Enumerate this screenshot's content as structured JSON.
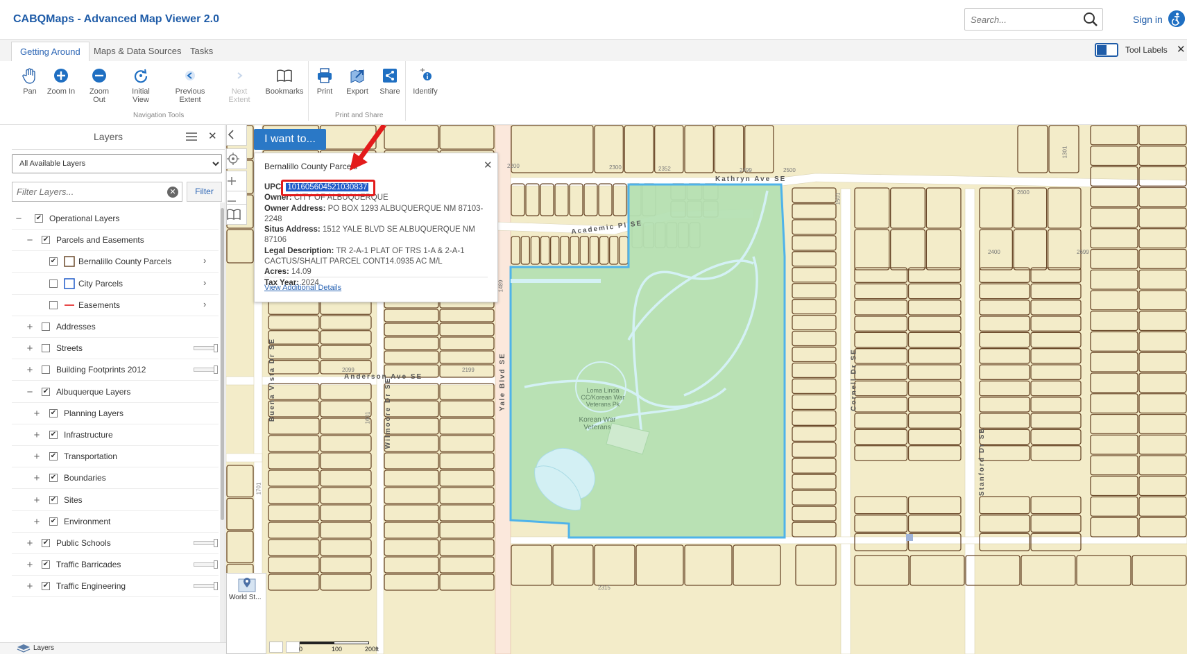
{
  "header": {
    "app_title": "CABQMaps - Advanced Map Viewer 2.0",
    "search_placeholder": "Search...",
    "sign_in": "Sign in"
  },
  "ribbon": {
    "tabs": [
      {
        "label": "Getting Around",
        "active": true
      },
      {
        "label": "Maps & Data Sources",
        "active": false
      },
      {
        "label": "Tasks",
        "active": false
      }
    ],
    "tool_labels": "Tool Labels",
    "tools": {
      "pan": "Pan",
      "zoom_in": "Zoom In",
      "zoom_out": "Zoom Out",
      "initial_view": "Initial View",
      "previous_extent": "Previous Extent",
      "next_extent": "Next Extent",
      "bookmarks": "Bookmarks",
      "print": "Print",
      "export": "Export",
      "share": "Share",
      "identify": "Identify"
    },
    "groups": {
      "navigation": "Navigation Tools",
      "print_share": "Print and Share"
    }
  },
  "layers_panel": {
    "title": "Layers",
    "selected_source": "All Available Layers",
    "filter_placeholder": "Filter Layers...",
    "filter_button": "Filter",
    "rows": [
      {
        "label": "Operational Layers",
        "expander": "−",
        "checked": true,
        "level": 0
      },
      {
        "label": "Parcels and Easements",
        "expander": "−",
        "checked": true,
        "level": 1
      },
      {
        "label": "Bernalillo County Parcels",
        "checked": true,
        "level": 2,
        "symbol": "parcel-brown"
      },
      {
        "label": "City Parcels",
        "checked": false,
        "level": 2,
        "symbol": "parcel-blue"
      },
      {
        "label": "Easements",
        "checked": false,
        "level": 2,
        "symbol": "line-red"
      },
      {
        "label": "Addresses",
        "expander": "+",
        "checked": false,
        "level": 1
      },
      {
        "label": "Streets",
        "expander": "+",
        "checked": false,
        "level": 1
      },
      {
        "label": "Building Footprints 2012",
        "expander": "+",
        "checked": false,
        "level": 1
      },
      {
        "label": "Albuquerque Layers",
        "expander": "−",
        "checked": true,
        "level": 1
      },
      {
        "label": "Planning Layers",
        "expander": "+",
        "checked": true,
        "level": 2
      },
      {
        "label": "Infrastructure",
        "expander": "+",
        "checked": true,
        "level": 2
      },
      {
        "label": "Transportation",
        "expander": "+",
        "checked": true,
        "level": 2
      },
      {
        "label": "Boundaries",
        "expander": "+",
        "checked": true,
        "level": 2
      },
      {
        "label": "Sites",
        "expander": "+",
        "checked": true,
        "level": 2
      },
      {
        "label": "Environment",
        "expander": "+",
        "checked": true,
        "level": 2
      },
      {
        "label": "Public Schools",
        "expander": "+",
        "checked": true,
        "level": 1
      },
      {
        "label": "Traffic Barricades",
        "expander": "+",
        "checked": true,
        "level": 1
      },
      {
        "label": "Traffic Engineering",
        "expander": "+",
        "checked": true,
        "level": 1
      }
    ],
    "footer_label": "Layers"
  },
  "map": {
    "i_want_to": "I want to...",
    "basemap_label": "World St...",
    "scale_labels": [
      "0",
      "100",
      "200ft"
    ],
    "streets": {
      "kathryn": "Kathryn Ave SE",
      "academic": "Academic Pl SE",
      "anderson": "Anderson Ave SE",
      "yale": "Yale Blvd SE",
      "buena_vista": "Buena Vista Dr SE",
      "wilmoore": "Wilmoore Dr SE",
      "cornell": "Cornell Dr SE",
      "stanford": "Stanford Dr SE"
    },
    "park_labels": {
      "loma_linda": "Loma Linda CC/Korean War Veterans Pk",
      "korean_war": "Korean War Veterans"
    },
    "addresses": [
      "2200",
      "2300",
      "2352",
      "2499",
      "2500",
      "2600",
      "2099",
      "2199",
      "2400",
      "2699",
      "1489",
      "1601",
      "1501",
      "1701",
      "2315",
      "1301"
    ]
  },
  "popup": {
    "title": "Bernalillo County Parcels",
    "fields": {
      "upc_label": "UPC:",
      "upc_value": "101605604521030837",
      "owner_label": "Owner:",
      "owner_value": "CITY OF ALBUQUERQUE",
      "owner_address_label": "Owner Address:",
      "owner_address_value": "PO BOX 1293 ALBUQUERQUE NM 87103-2248",
      "situs_label": "Situs Address:",
      "situs_value": "1512 YALE BLVD SE ALBUQUERQUE NM 87106",
      "legal_label": "Legal Description:",
      "legal_value": "TR 2-A-1 PLAT OF TRS 1-A & 2-A-1 CACTUS/SHALIT PARCEL CONT14.0935 AC M/L",
      "acres_label": "Acres:",
      "acres_value": "14.09",
      "tax_year_label": "Tax Year:",
      "tax_year_value": "2024"
    },
    "link": "View Additional Details"
  },
  "colors": {
    "brand": "#1f5ca8",
    "accent": "#2a78c6",
    "annotation_red": "#e31b1b",
    "parcel_fill": "#f3ecc9",
    "parcel_line": "#6b4a2b",
    "park_fill": "#b5e0b3",
    "selection_outline": "#4fb3ea"
  }
}
